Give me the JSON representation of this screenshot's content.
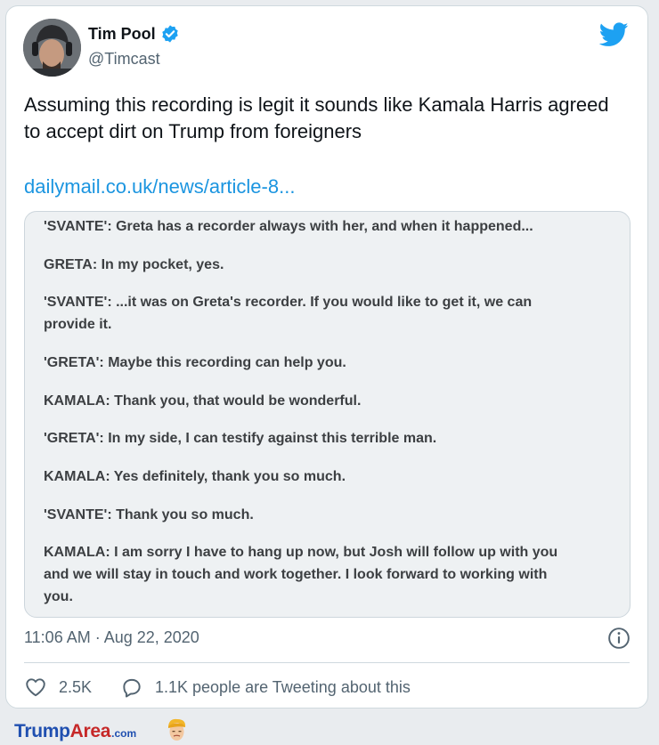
{
  "tweet": {
    "author_name": "Tim Pool",
    "handle": "@Timcast",
    "text": "Assuming this recording is legit it sounds like Kamala Harris agreed to accept dirt on Trump from foreigners",
    "link_text": "dailymail.co.uk/news/article-8...",
    "timestamp": "11:06 AM · Aug 22, 2020",
    "likes": "2.5K",
    "discussion": "1.1K people are Tweeting about this"
  },
  "quote_lines": [
    "'SVANTE': Greta has a recorder always with her, and when it happened...",
    "GRETA: In my pocket, yes.",
    "'SVANTE': ...it was on Greta's recorder. If you would like to get it, we can",
    "provide it.",
    "'GRETA': Maybe this recording can help you.",
    "KAMALA: Thank you, that would be wonderful.",
    "'GRETA': In my side, I can testify against this terrible man.",
    "KAMALA: Yes definitely, thank you so much.",
    "'SVANTE': Thank you so much.",
    "KAMALA: I am sorry I have to hang up now, but Josh will follow up with you",
    "and we will stay in touch and work together. I look forward to working with",
    "you."
  ],
  "watermark": {
    "part1": "Trump",
    "part2": "Area",
    "part3": ".com"
  },
  "colors": {
    "link": "#1b95e0",
    "verified": "#1da1f2",
    "card_border": "#cfd9de",
    "quote_bg": "#eef1f3"
  },
  "icons": [
    "verified-badge-icon",
    "twitter-bird-icon",
    "info-icon",
    "heart-icon",
    "speech-bubble-icon"
  ]
}
